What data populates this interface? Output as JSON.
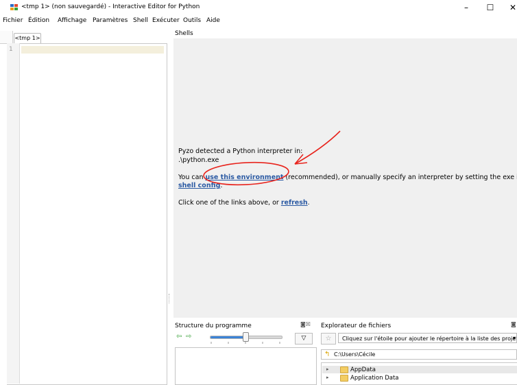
{
  "window": {
    "title": "<tmp 1> (non sauvegardé) - Interactive Editor for Python",
    "controls": {
      "minimize": "–",
      "maximize": "☐",
      "close": "✕"
    }
  },
  "menu": [
    "Fichier",
    "Édition",
    "Affichage",
    "Paramètres",
    "Shell",
    "Exécuter",
    "Outils",
    "Aide"
  ],
  "editor": {
    "tab_label": "<tmp 1>",
    "line_number": "1"
  },
  "shells": {
    "label": "Shells",
    "line1": "Pyzo detected a Python interpreter in:",
    "line2": ".\\python.exe",
    "line3_pre": "You can ",
    "link_use_env": "use this environment",
    "line3_mid": " (recommended), or manually specify an interpreter by setting the exe in the",
    "link_shell_config": "shell config",
    "line4_post": ".",
    "line5_pre": "Click one of the links above, or ",
    "link_refresh": "refresh",
    "line5_post": "."
  },
  "structure": {
    "title": "Structure du programme",
    "controls": "◙☒",
    "arrow_left": "⇦",
    "arrow_right": "⇨",
    "filter_icon": "▽",
    "slider_level": 0.5
  },
  "file_explorer": {
    "title": "Explorateur de fichiers",
    "controls": "◙",
    "star_icon": "☆",
    "project_placeholder": "Cliquez sur l'étoile pour ajouter le répertoire à la liste des projets",
    "dropdown_arrow": "▾",
    "path": "C:\\Users\\Cécile",
    "items": [
      {
        "label": "AppData",
        "expand": "▸"
      },
      {
        "label": "Application Data",
        "expand": "▸"
      }
    ]
  },
  "colors": {
    "link": "#2b5aa3",
    "annotation": "#e8231c",
    "slider_fill": "#3c83d6",
    "folder": "#f3cd63"
  }
}
